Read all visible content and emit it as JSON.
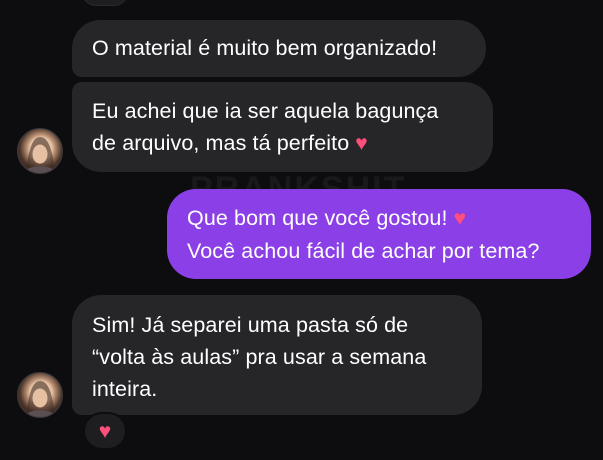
{
  "watermark": "PRANKSHIT",
  "messages": [
    {
      "lines": [
        "O material é muito bem organizado!"
      ]
    },
    {
      "lines": [
        "Eu achei que ia ser aquela bagunça",
        "de arquivo, mas tá perfeito"
      ]
    },
    {
      "lines": [
        "Que bom que você gostou!",
        "Você achou fácil de achar por tema?"
      ]
    },
    {
      "lines": [
        "Sim! Já separei uma pasta só de",
        "“volta às aulas” pra usar a semana",
        "inteira."
      ]
    }
  ],
  "icons": {
    "heart": "♥",
    "reaction": "♥"
  },
  "colors": {
    "background": "#0d0d10",
    "incoming_bubble": "#262629",
    "outgoing_bubble": "#8b3fe6",
    "heart": "#ff4f7b"
  }
}
